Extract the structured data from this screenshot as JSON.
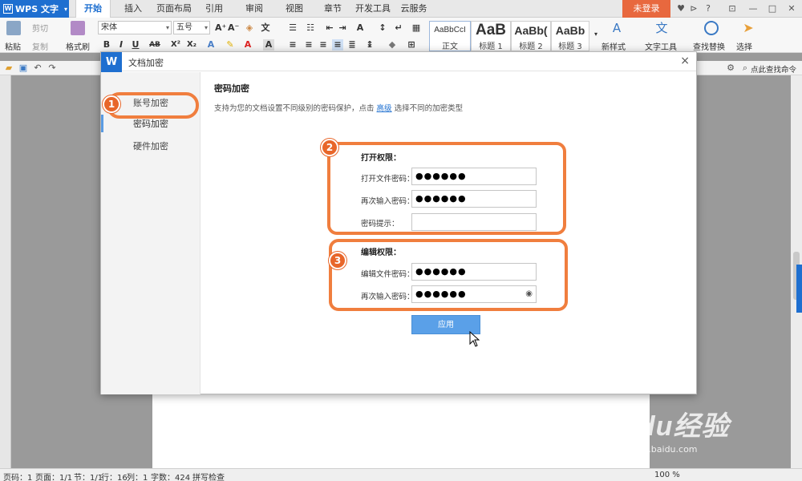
{
  "app": {
    "name": "WPS 文字",
    "tabs": [
      "开始",
      "插入",
      "页面布局",
      "引用",
      "审阅",
      "视图",
      "章节",
      "开发工具",
      "云服务"
    ],
    "active_tab": "开始",
    "login_label": "未登录"
  },
  "ribbon": {
    "paste": "粘贴",
    "cut": "剪切",
    "copy": "复制",
    "format_painter": "格式刷",
    "font_name": "宋体",
    "font_size": "五号",
    "styles": [
      {
        "preview": "AaBbCcI",
        "caption": "正文"
      },
      {
        "preview": "AaB",
        "caption": "标题 1"
      },
      {
        "preview": "AaBb(",
        "caption": "标题 2"
      },
      {
        "preview": "AaBb",
        "caption": "标题 3"
      }
    ],
    "new_style": "新样式",
    "text_tools": "文字工具",
    "find_replace": "查找替换",
    "select": "选择",
    "find_command": "点此查找命令"
  },
  "dialog": {
    "title": "文档加密",
    "nav": [
      "账号加密",
      "密码加密",
      "硬件加密"
    ],
    "active_nav": "密码加密",
    "heading": "密码加密",
    "desc_before": "支持为您的文档设置不同级别的密码保护，点击",
    "desc_link": "高级",
    "desc_after": "选择不同的加密类型",
    "open_section": {
      "title": "打开权限：",
      "fields": [
        {
          "label": "打开文件密码：",
          "value": "●●●●●●"
        },
        {
          "label": "再次输入密码：",
          "value": "●●●●●●"
        },
        {
          "label": "密码提示：",
          "value": ""
        }
      ]
    },
    "edit_section": {
      "title": "编辑权限：",
      "fields": [
        {
          "label": "编辑文件密码：",
          "value": "●●●●●●"
        },
        {
          "label": "再次输入密码：",
          "value": "●●●●●●"
        }
      ]
    },
    "apply_label": "应用",
    "close_glyph": "×"
  },
  "annotations": [
    "1",
    "2",
    "3"
  ],
  "status": {
    "page_code": "页码：1",
    "pages": "页面：1/1",
    "section": "节：1/1",
    "row": "行：16",
    "col": "列：1",
    "words": "字数：424",
    "spell": "拼写检查",
    "zoom": "100 %"
  },
  "watermark": {
    "brand": "Baidu经验",
    "url": "jingyan.baidu.com"
  },
  "colors": {
    "accent": "#1e6fd0",
    "annotation": "#f07e3e",
    "login": "#e8683e",
    "apply": "#5aa0e8"
  }
}
